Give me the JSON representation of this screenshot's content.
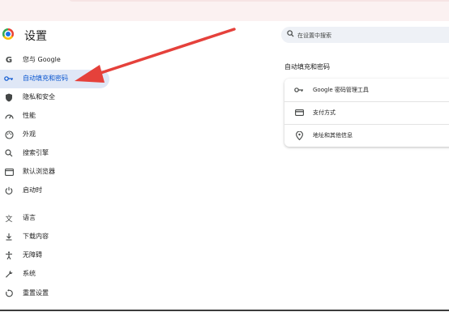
{
  "header": {
    "title": "设置"
  },
  "search": {
    "placeholder": "在设置中搜索"
  },
  "sidebar": {
    "items": [
      {
        "label": "您与 Google",
        "icon": "google-icon",
        "active": false
      },
      {
        "label": "自动填充和密码",
        "icon": "key-icon",
        "active": true
      },
      {
        "label": "隐私和安全",
        "icon": "shield-icon",
        "active": false
      },
      {
        "label": "性能",
        "icon": "gauge-icon",
        "active": false
      },
      {
        "label": "外观",
        "icon": "palette-icon",
        "active": false
      },
      {
        "label": "搜索引擎",
        "icon": "search-icon",
        "active": false
      },
      {
        "label": "默认浏览器",
        "icon": "browser-window-icon",
        "active": false
      },
      {
        "label": "启动时",
        "icon": "power-icon",
        "active": false
      },
      {
        "label": "语言",
        "icon": "translate-icon",
        "active": false
      },
      {
        "label": "下载内容",
        "icon": "download-icon",
        "active": false
      },
      {
        "label": "无障碍",
        "icon": "accessibility-icon",
        "active": false
      },
      {
        "label": "系统",
        "icon": "wrench-icon",
        "active": false
      },
      {
        "label": "重置设置",
        "icon": "reset-icon",
        "active": false
      }
    ]
  },
  "main": {
    "section_title": "自动填充和密码",
    "rows": [
      {
        "label": "Google 密码管理工具",
        "icon": "key-icon"
      },
      {
        "label": "支付方式",
        "icon": "credit-card-icon"
      },
      {
        "label": "地址和其他信息",
        "icon": "location-pin-icon"
      }
    ]
  },
  "colors": {
    "accent": "#0b57d0",
    "active_bg": "#dfe7f6",
    "annotation": "#e5413b"
  }
}
